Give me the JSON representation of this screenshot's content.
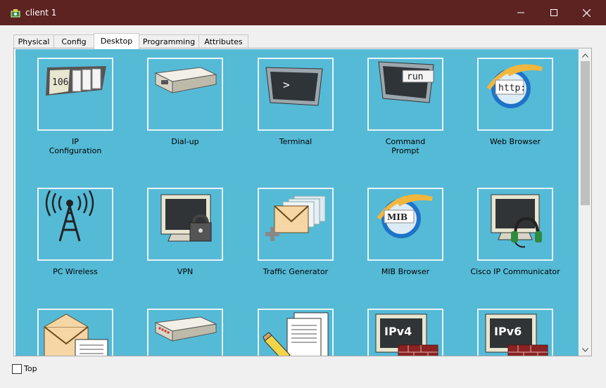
{
  "window": {
    "title": "client 1",
    "controls": {
      "minimize": "minimize-icon",
      "maximize": "maximize-icon",
      "close": "close-icon"
    }
  },
  "tabs": [
    {
      "label": "Physical"
    },
    {
      "label": "Config"
    },
    {
      "label": "Desktop",
      "active": true
    },
    {
      "label": "Programming"
    },
    {
      "label": "Attributes"
    }
  ],
  "desktop": {
    "background": "#55bad6",
    "apps": [
      {
        "label": "IP\nConfiguration",
        "icon": "ip-config-icon",
        "badge": "106"
      },
      {
        "label": "Dial-up",
        "icon": "modem-icon"
      },
      {
        "label": "Terminal",
        "icon": "terminal-icon",
        "glyph": ">"
      },
      {
        "label": "Command\nPrompt",
        "icon": "command-prompt-icon",
        "badge": "run"
      },
      {
        "label": "Web Browser",
        "icon": "web-browser-icon",
        "badge": "http:"
      },
      {
        "label": "PC Wireless",
        "icon": "wireless-tower-icon"
      },
      {
        "label": "VPN",
        "icon": "vpn-lock-icon"
      },
      {
        "label": "Traffic Generator",
        "icon": "traffic-generator-icon"
      },
      {
        "label": "MIB Browser",
        "icon": "mib-browser-icon",
        "badge": "MIB"
      },
      {
        "label": "Cisco IP Communicator",
        "icon": "ip-communicator-icon"
      },
      {
        "label": "",
        "icon": "email-icon"
      },
      {
        "label": "",
        "icon": "router-box-icon"
      },
      {
        "label": "",
        "icon": "text-editor-icon"
      },
      {
        "label": "",
        "icon": "ipv4-firewall-icon",
        "badge": "IPv4"
      },
      {
        "label": "",
        "icon": "ipv6-firewall-icon",
        "badge": "IPv6"
      }
    ]
  },
  "footer": {
    "top_label": "Top",
    "top_checked": false
  }
}
